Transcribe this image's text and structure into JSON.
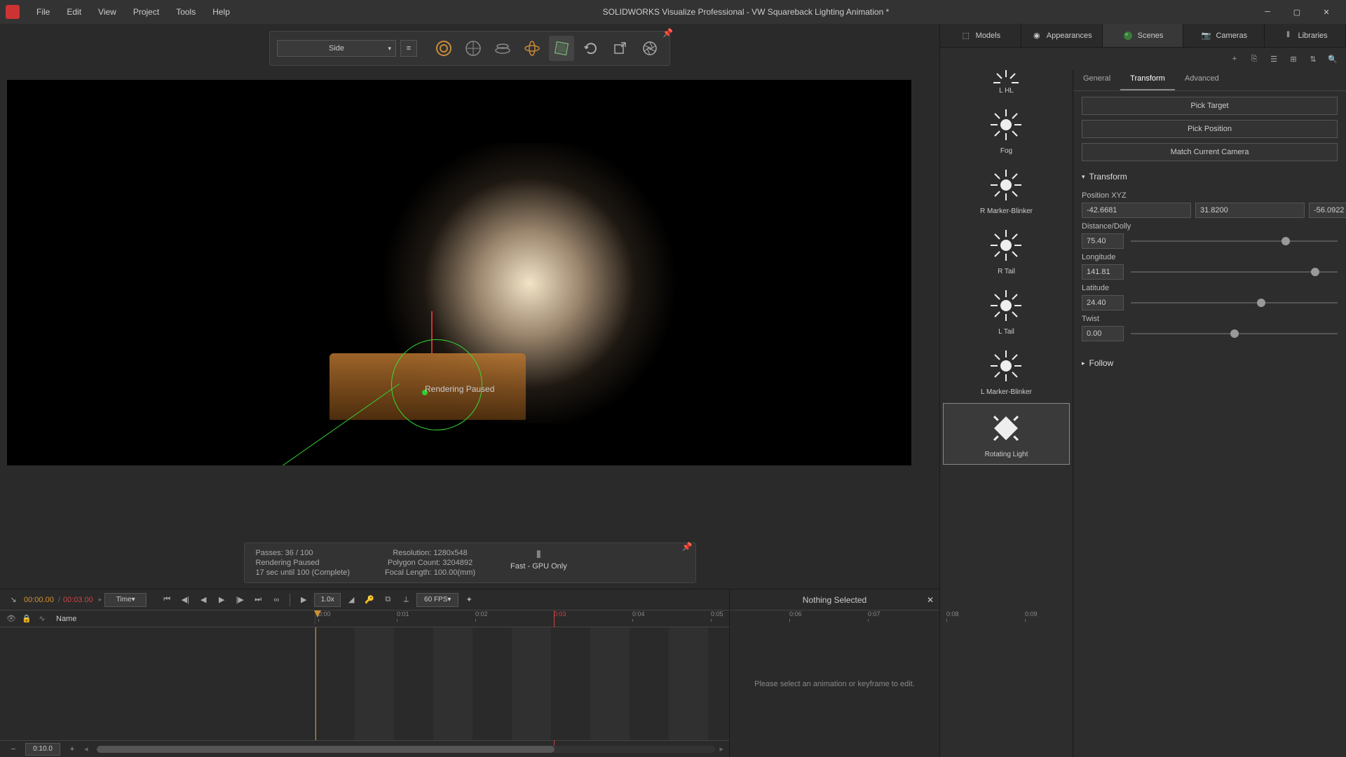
{
  "titlebar": {
    "title": "SOLIDWORKS Visualize Professional - VW Squareback Lighting Animation *",
    "menus": [
      "File",
      "Edit",
      "View",
      "Project",
      "Tools",
      "Help"
    ]
  },
  "toolbar": {
    "camera": "Side"
  },
  "viewport": {
    "status": "Rendering Paused"
  },
  "info": {
    "passes": "Passes: 36 /  100",
    "status": "Rendering Paused",
    "eta": "17 sec until 100 (Complete)",
    "resolution": "Resolution: 1280x548",
    "polycount": "Polygon Count: 3204892",
    "focal": "Focal Length: 100.00(mm)",
    "mode": "Fast - GPU Only"
  },
  "right_tabs": [
    "Models",
    "Appearances",
    "Scenes",
    "Cameras",
    "Libraries"
  ],
  "lights": [
    {
      "name": "L HL"
    },
    {
      "name": "Fog"
    },
    {
      "name": "R Marker-Blinker"
    },
    {
      "name": "R Tail"
    },
    {
      "name": "L Tail"
    },
    {
      "name": "L Marker-Blinker"
    },
    {
      "name": "Rotating Light"
    }
  ],
  "props": {
    "tabs": [
      "General",
      "Transform",
      "Advanced"
    ],
    "pick_target": "Pick Target",
    "pick_position": "Pick Position",
    "match_camera": "Match Current Camera",
    "transform_header": "Transform",
    "position_label": "Position XYZ",
    "position": [
      "-42.6681",
      "31.8200",
      "-56.0922"
    ],
    "distance_label": "Distance/Dolly",
    "distance": "75.40",
    "longitude_label": "Longitude",
    "longitude": "141.81",
    "latitude_label": "Latitude",
    "latitude": "24.40",
    "twist_label": "Twist",
    "twist": "0.00",
    "follow_header": "Follow"
  },
  "timeline": {
    "current": "00:00.00",
    "total": "00:03.00",
    "mode": "Time",
    "speed": "1.0x",
    "fps": "60 FPS",
    "name_header": "Name",
    "zoom": "0:10.0",
    "ticks": [
      "0:00",
      "0:01",
      "0:02",
      "0:03",
      "0:04",
      "0:05",
      "0:06",
      "0:07",
      "0:08",
      "0:09"
    ],
    "side_title": "Nothing Selected",
    "side_msg": "Please select an animation or keyframe to edit."
  }
}
